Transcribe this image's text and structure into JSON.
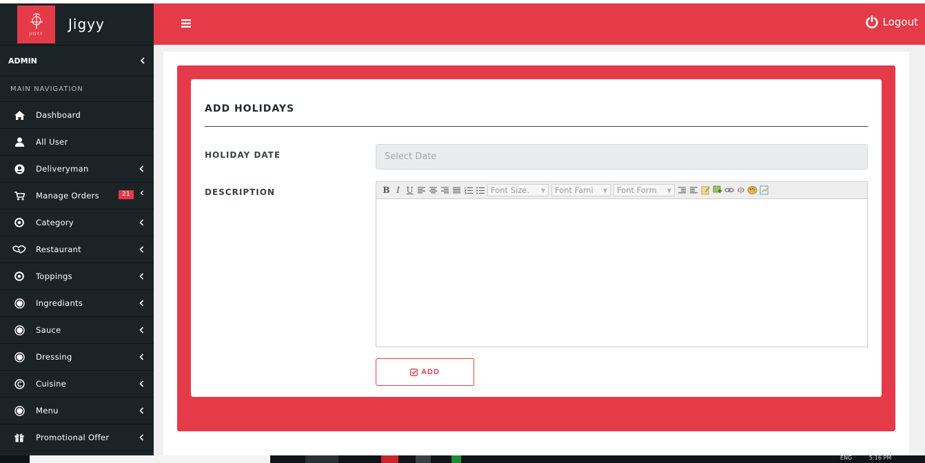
{
  "brand": {
    "name": "Jigyy",
    "logo_text": "JIGYY"
  },
  "sidebar": {
    "admin_label": "ADMIN",
    "nav_header": "MAIN NAVIGATION",
    "items": [
      {
        "label": "Dashboard",
        "icon": "home-icon",
        "chevron": false
      },
      {
        "label": "All User",
        "icon": "user-icon",
        "chevron": false
      },
      {
        "label": "Deliveryman",
        "icon": "user-circle-icon",
        "chevron": true
      },
      {
        "label": "Manage Orders",
        "icon": "cart-icon",
        "chevron": true,
        "badge": "21"
      },
      {
        "label": "Category",
        "icon": "dot-circle-icon",
        "chevron": true
      },
      {
        "label": "Restaurant",
        "icon": "handshake-icon",
        "chevron": true
      },
      {
        "label": "Toppings",
        "icon": "dot-circle-icon",
        "chevron": true
      },
      {
        "label": "Ingrediants",
        "icon": "record-icon",
        "chevron": true
      },
      {
        "label": "Sauce",
        "icon": "record-icon",
        "chevron": true
      },
      {
        "label": "Dressing",
        "icon": "record-icon",
        "chevron": true
      },
      {
        "label": "Cuisine",
        "icon": "copyright-icon",
        "chevron": true
      },
      {
        "label": "Menu",
        "icon": "record-icon",
        "chevron": true
      },
      {
        "label": "Promotional Offer",
        "icon": "gift-icon",
        "chevron": true
      }
    ]
  },
  "header": {
    "logout_label": "Logout"
  },
  "form": {
    "title": "ADD HOLIDAYS",
    "holiday_date_label": "HOLIDAY DATE",
    "holiday_date_placeholder": "Select Date",
    "description_label": "DESCRIPTION",
    "toolbar": {
      "font_size": "Font Size.",
      "font_family": "Font Fami",
      "font_format": "Font Form"
    },
    "add_label": "ADD"
  },
  "taskbar": {
    "lang": "ENG",
    "time": "5:16 PM"
  },
  "colors": {
    "accent": "#e53a48",
    "sidebar": "#1b2327"
  }
}
